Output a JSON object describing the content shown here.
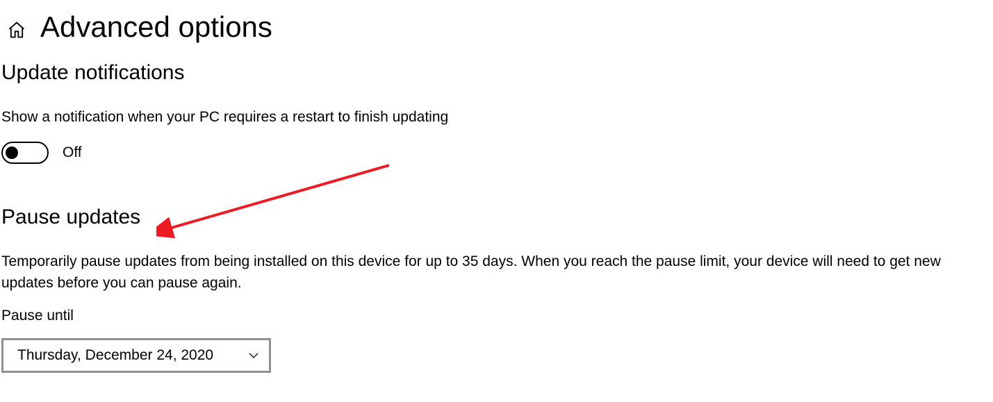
{
  "header": {
    "title": "Advanced options"
  },
  "notifications": {
    "heading": "Update notifications",
    "description": "Show a notification when your PC requires a restart to finish updating",
    "toggle_state": "Off"
  },
  "pause": {
    "heading": "Pause updates",
    "description": "Temporarily pause updates from being installed on this device for up to 35 days. When you reach the pause limit, your device will need to get new updates before you can pause again.",
    "field_label": "Pause until",
    "selected_date": "Thursday, December 24, 2020"
  },
  "annotation": {
    "arrow_color": "#ED1C24"
  }
}
